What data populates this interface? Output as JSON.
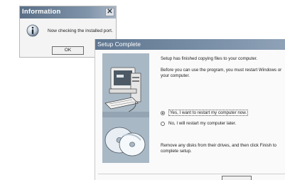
{
  "info_dialog": {
    "title": "Information",
    "close_glyph": "✕",
    "message": "Now checking the installed port.",
    "ok_label": "OK"
  },
  "setup_dialog": {
    "title": "Setup Complete",
    "text_copied": "Setup has finished copying files to your computer.",
    "text_restart": "Before you can use the program, you must restart Windows or your computer.",
    "option_restart_now": "Yes, I want to restart my computer now.",
    "option_restart_later": "No, I will restart my computer later.",
    "selected_option": "restart_now",
    "text_finish": "Remove any disks from their drives, and then click Finish to complete setup."
  },
  "colors": {
    "title_bar": "#5f7690",
    "art_panel": "#a9b8c5"
  },
  "icons": [
    "info-icon",
    "close-icon",
    "computer-illustration",
    "disc-illustration"
  ]
}
